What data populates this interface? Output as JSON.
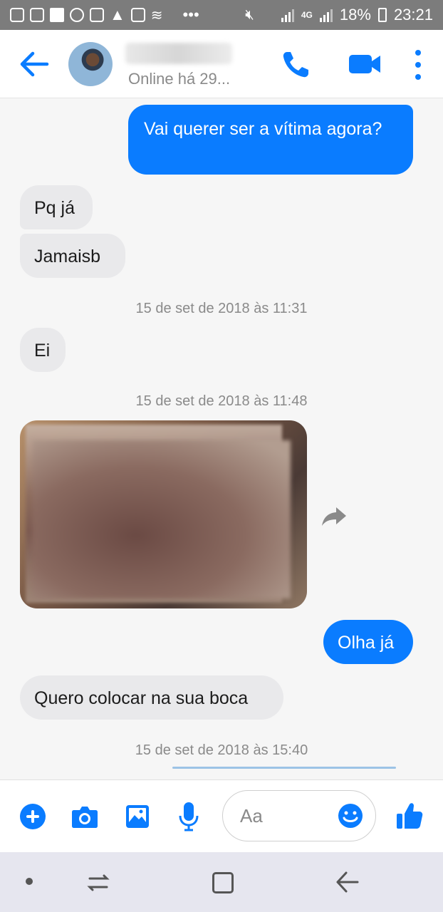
{
  "status_bar": {
    "battery": "18%",
    "time": "23:21",
    "network": "4G"
  },
  "header": {
    "online_status": "Online há 29..."
  },
  "messages": [
    {
      "direction": "sent",
      "text": "Vai querer ser a vítima agora?"
    },
    {
      "direction": "received",
      "text": "Pq já"
    },
    {
      "direction": "received",
      "text": "Jamaisb"
    },
    {
      "direction": "received",
      "text": "Ei"
    },
    {
      "direction": "sent",
      "text": "Olha já"
    },
    {
      "direction": "received",
      "text": "Quero colocar na sua boca"
    }
  ],
  "timestamps": [
    "15 de set de 2018 às 11:31",
    "15 de set de 2018 às 11:48",
    "15 de set de 2018 às 15:40"
  ],
  "composer": {
    "placeholder": "Aa"
  },
  "colors": {
    "accent": "#0a7cff",
    "received_bubble": "#e9e9eb",
    "status_bar": "#7c7c7c"
  },
  "icons": {
    "back": "arrow-left-icon",
    "call": "phone-icon",
    "video": "video-camera-icon",
    "more": "kebab-menu-icon",
    "share": "forward-arrow-icon",
    "plus": "plus-icon",
    "camera": "camera-icon",
    "gallery": "image-icon",
    "mic": "microphone-icon",
    "emoji": "smiley-icon",
    "like": "thumbs-up-icon"
  }
}
